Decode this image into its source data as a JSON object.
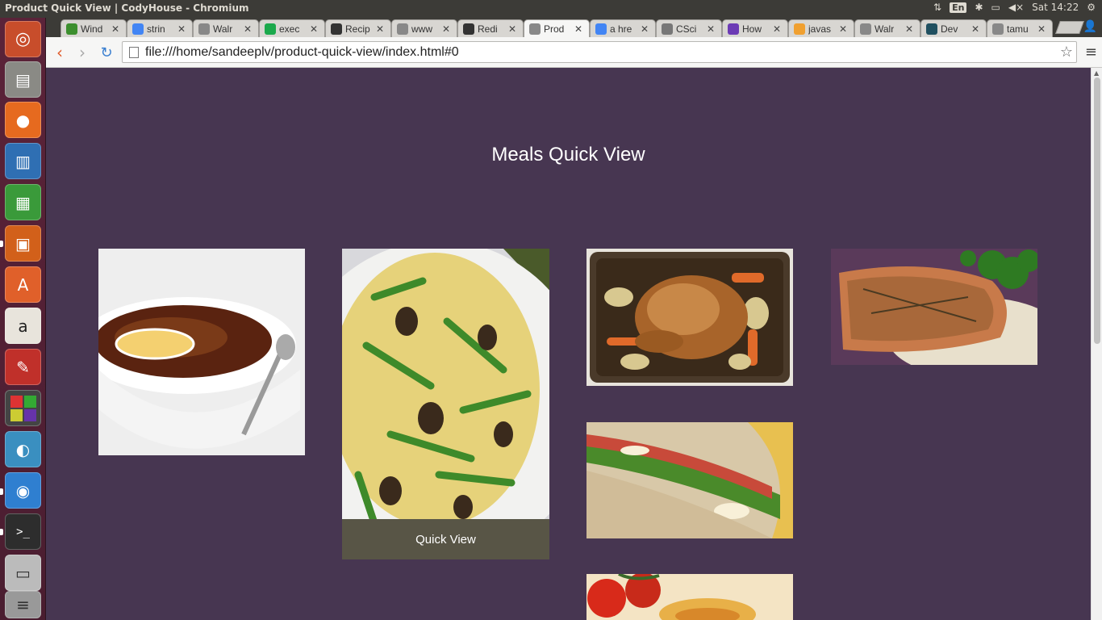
{
  "window": {
    "title": "Product Quick View | CodyHouse - Chromium",
    "indicators": {
      "keyboard": "En",
      "clock": "Sat 14:22"
    }
  },
  "launcher": {
    "icons": [
      "ubuntu-dash-icon",
      "files-icon",
      "firefox-icon",
      "writer-icon",
      "calc-icon",
      "impress-icon",
      "software-center-icon",
      "amazon-icon",
      "system-settings-icon",
      "workspaces-icon",
      "network-icon",
      "chromium-icon",
      "terminal-icon",
      "storage-icon",
      "trash-icon"
    ]
  },
  "tabs": [
    {
      "title": "Wind",
      "icon": "vine-icon",
      "color": "#3c8f2e"
    },
    {
      "title": "strin",
      "icon": "google-icon",
      "color": "#4285f4"
    },
    {
      "title": "Walr",
      "icon": "page-icon",
      "color": "#888888"
    },
    {
      "title": "exec",
      "icon": "hackerrank-icon",
      "color": "#1ba94c"
    },
    {
      "title": "Recip",
      "icon": "github-icon",
      "color": "#333333"
    },
    {
      "title": "www",
      "icon": "page-icon",
      "color": "#888888"
    },
    {
      "title": "Redi",
      "icon": "settings-icon",
      "color": "#333333"
    },
    {
      "title": "Prod",
      "icon": "page-icon",
      "color": "#888888",
      "active": true
    },
    {
      "title": "a hre",
      "icon": "google-icon",
      "color": "#4285f4"
    },
    {
      "title": "CSci",
      "icon": "database-icon",
      "color": "#777777"
    },
    {
      "title": "How",
      "icon": "video-icon",
      "color": "#6c3bb5"
    },
    {
      "title": "javas",
      "icon": "code-icon",
      "color": "#f0a030"
    },
    {
      "title": "Walr",
      "icon": "page-icon",
      "color": "#888888"
    },
    {
      "title": "Dev",
      "icon": "devdocs-icon",
      "color": "#205060"
    },
    {
      "title": "tamu",
      "icon": "page-icon",
      "color": "#888888"
    }
  ],
  "address_bar": {
    "url": "file:///home/sandeeplv/product-quick-view/index.html#0"
  },
  "page": {
    "title": "Meals Quick View",
    "quick_view_label": "Quick View",
    "meals": [
      {
        "name": "soup-image",
        "dish": "tomato soup with lemon"
      },
      {
        "name": "asparagus-eggs-image",
        "dish": "scrambled eggs with asparagus and morels"
      },
      {
        "name": "roast-chicken-image",
        "dish": "roast chicken with vegetables"
      },
      {
        "name": "salmon-image",
        "dish": "baked salmon with rice and broccoli"
      },
      {
        "name": "sandwich-image",
        "dish": "sandwich with tomato and greens"
      },
      {
        "name": "pasta-image",
        "dish": "pasta with tomatoes"
      }
    ]
  }
}
